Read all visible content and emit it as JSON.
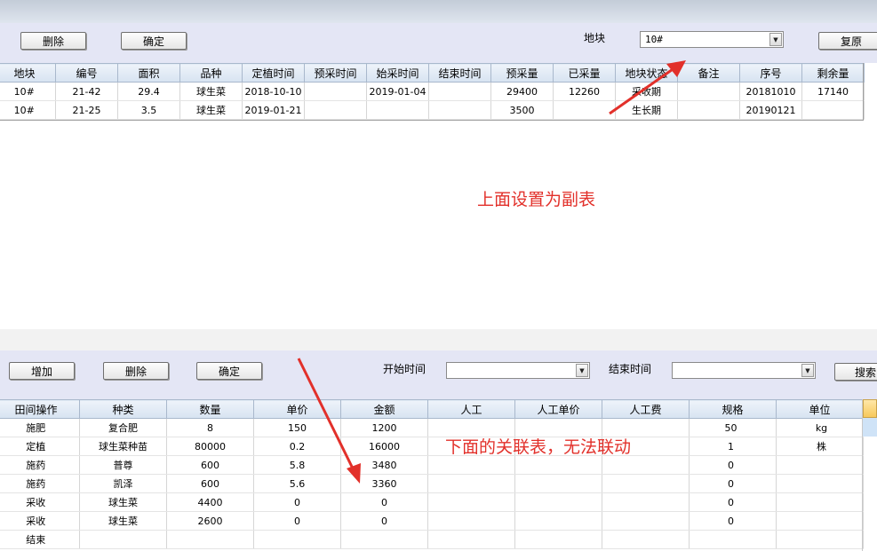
{
  "upper_toolbar": {
    "delete_label": "删除",
    "confirm_label": "确定",
    "plot_label": "地块",
    "plot_value": "10#",
    "restore_label": "复原"
  },
  "upper_table": {
    "headers": [
      "地块",
      "编号",
      "面积",
      "品种",
      "定植时间",
      "预采时间",
      "始采时间",
      "结束时间",
      "预采量",
      "已采量",
      "地块状态",
      "备注",
      "序号",
      "剩余量"
    ],
    "rows": [
      [
        "10#",
        "21-42",
        "29.4",
        "球生菜",
        "2018-10-10",
        "",
        "2019-01-04",
        "",
        "29400",
        "12260",
        "采收期",
        "",
        "20181010",
        "17140"
      ],
      [
        "10#",
        "21-25",
        "3.5",
        "球生菜",
        "2019-01-21",
        "",
        "",
        "",
        "3500",
        "",
        "生长期",
        "",
        "20190121",
        ""
      ]
    ]
  },
  "annotations": {
    "upper_note": "上面设置为副表",
    "lower_note": "下面的关联表，无法联动"
  },
  "lower_toolbar": {
    "add_label": "增加",
    "delete_label": "删除",
    "confirm_label": "确定",
    "start_label": "开始时间",
    "start_value": "",
    "end_label": "结束时间",
    "end_value": "",
    "search_label": "搜索"
  },
  "lower_table": {
    "headers": [
      "田间操作",
      "种类",
      "数量",
      "单价",
      "金额",
      "人工",
      "人工单价",
      "人工费",
      "规格",
      "单位"
    ],
    "rows": [
      [
        "施肥",
        "复合肥",
        "8",
        "150",
        "1200",
        "",
        "",
        "",
        "50",
        "kg"
      ],
      [
        "定植",
        "球生菜种苗",
        "80000",
        "0.2",
        "16000",
        "",
        "",
        "",
        "1",
        "株"
      ],
      [
        "施药",
        "普尊",
        "600",
        "5.8",
        "3480",
        "",
        "",
        "",
        "0",
        ""
      ],
      [
        "施药",
        "凯泽",
        "600",
        "5.6",
        "3360",
        "",
        "",
        "",
        "0",
        ""
      ],
      [
        "采收",
        "球生菜",
        "4400",
        "0",
        "0",
        "",
        "",
        "",
        "0",
        ""
      ],
      [
        "采收",
        "球生菜",
        "2600",
        "0",
        "0",
        "",
        "",
        "",
        "0",
        ""
      ],
      [
        "结束",
        "",
        "",
        "",
        "",
        "",
        "",
        "",
        "",
        ""
      ]
    ]
  },
  "colors": {
    "annotation": "#e2302a",
    "toolbar_bg": "#e4e6f5",
    "header_bg": "#d7e3f1"
  }
}
